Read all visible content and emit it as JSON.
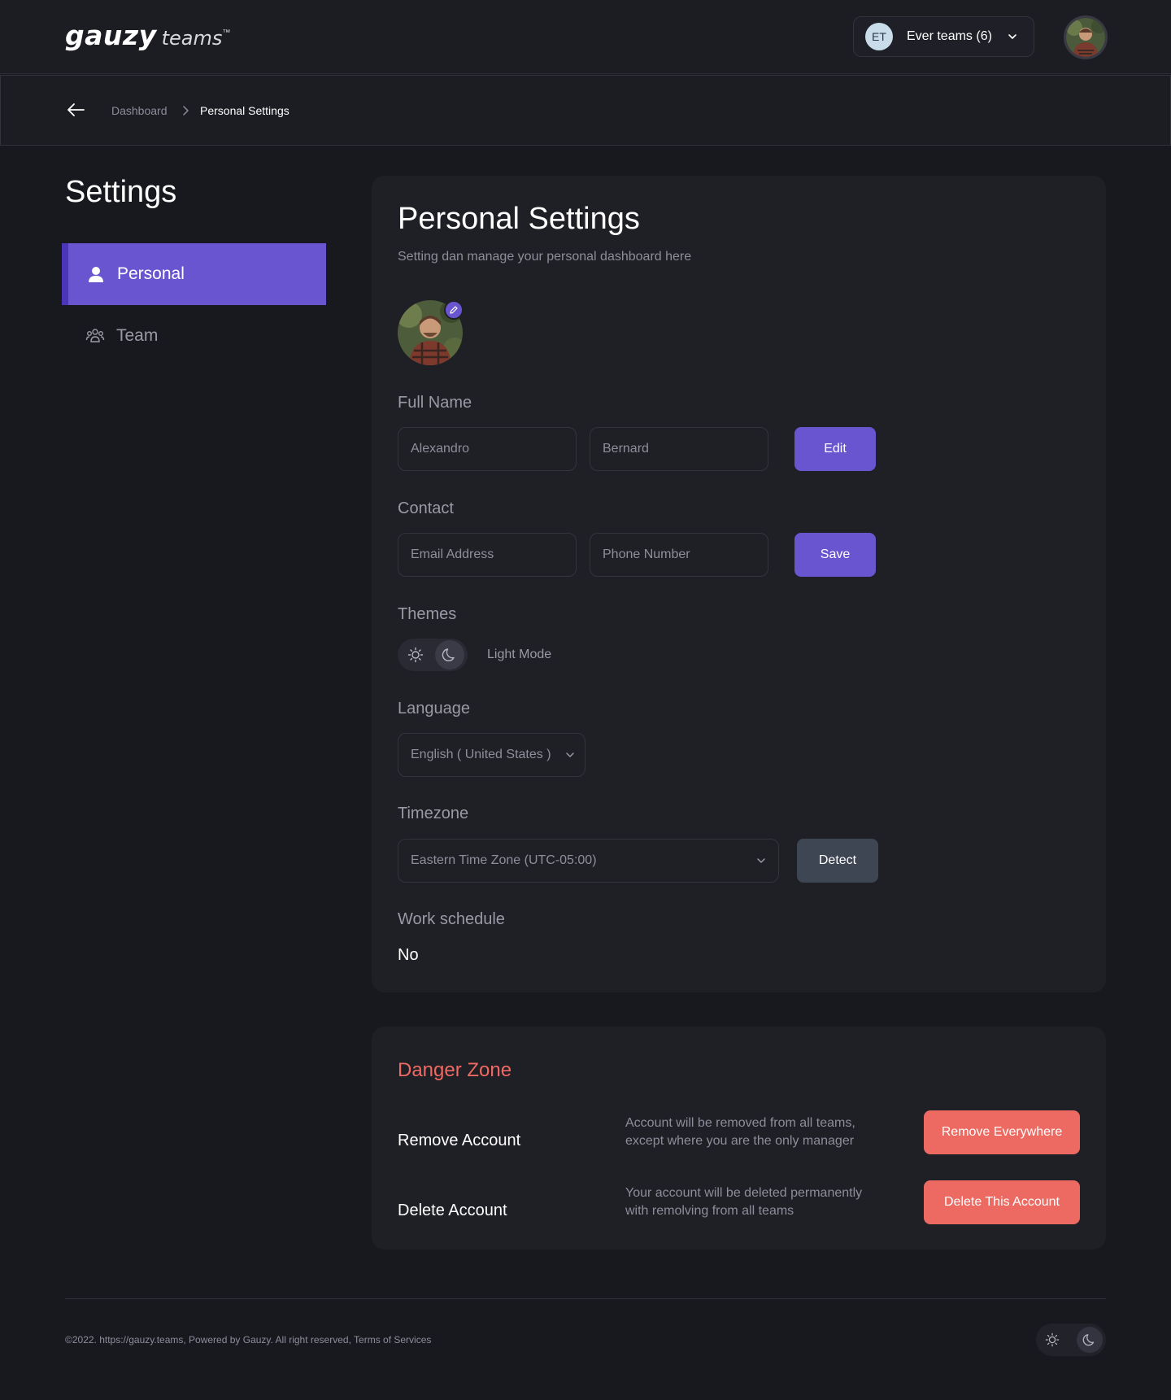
{
  "header": {
    "logo_main": "gauzy",
    "logo_sub": "teams",
    "logo_tm": "™",
    "team_initials": "ET",
    "team_label": "Ever teams (6)"
  },
  "breadcrumb": {
    "items": [
      "Dashboard",
      "Personal Settings"
    ]
  },
  "sidebar": {
    "title": "Settings",
    "items": [
      {
        "label": "Personal",
        "icon": "user-icon",
        "active": true
      },
      {
        "label": "Team",
        "icon": "team-icon",
        "active": false
      }
    ]
  },
  "personal": {
    "title": "Personal Settings",
    "subtitle": "Setting dan manage your personal dashboard here",
    "full_name_label": "Full Name",
    "first_name_placeholder": "Alexandro",
    "last_name_placeholder": "Bernard",
    "edit_label": "Edit",
    "contact_label": "Contact",
    "email_placeholder": "Email Address",
    "phone_placeholder": "Phone Number",
    "save_label": "Save",
    "themes_label": "Themes",
    "theme_mode": "Light Mode",
    "language_label": "Language",
    "language_value": "English ( United States )",
    "timezone_label": "Timezone",
    "timezone_value": "Eastern Time Zone (UTC-05:00)",
    "detect_label": "Detect",
    "work_schedule_label": "Work schedule",
    "work_schedule_value": "No"
  },
  "danger": {
    "title": "Danger Zone",
    "remove_title": "Remove Account",
    "remove_desc": "Account will be removed from all teams, except where you are the only manager",
    "remove_btn": "Remove Everywhere",
    "delete_title": "Delete Account",
    "delete_desc": "Your account will be deleted permanently with remolving from all teams",
    "delete_btn": "Delete This Account"
  },
  "footer": {
    "copyright": "©2022. https://gauzy.teams, Powered by Gauzy. All right reserved, ",
    "tos": "Terms of Services"
  },
  "colors": {
    "accent": "#6a55d0",
    "danger": "#ec6a62",
    "background": "#18181f",
    "card": "#1f1f26"
  }
}
